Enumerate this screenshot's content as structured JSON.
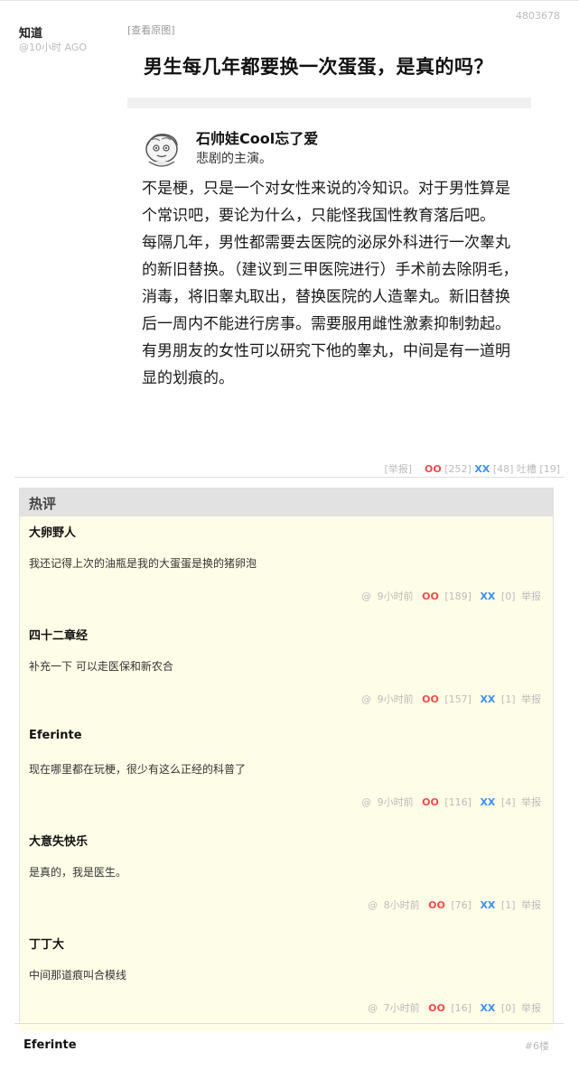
{
  "post": {
    "author": "知道",
    "time": "@10小时 AGO",
    "id": "4803678",
    "view_original": "[查看原图]",
    "image": {
      "title": "男生每几年都要换一次蛋蛋，是真的吗？",
      "user": "石帅娃Cool忘了爱",
      "bio": "悲剧的主演。",
      "paragraphs": [
        "不是梗，只是一个对女性来说的冷知识。对于男性算是个常识吧，要论为什么，只能怪我国性教育落后吧。",
        "每隔几年，男性都需要去医院的泌尿外科进行一次睾丸的新旧替换。（建议到三甲医院进行）手术前去除阴毛，消毒，将旧睾丸取出，替换医院的人造睾丸。新旧替换后一周内不能进行房事。需要服用雌性激素抑制勃起。",
        "有男朋友的女性可以研究下他的睾丸，中间是有一道明显的划痕的。"
      ]
    },
    "actions": {
      "report": "[举报]",
      "oo_label": "OO",
      "oo_count": "[252]",
      "xx_label": "XX",
      "xx_count": "[48]",
      "tucao_label": "吐槽",
      "tucao_count": "[19]"
    }
  },
  "hot": {
    "title": "热评",
    "comments": [
      {
        "author": "大卵野人",
        "text": "我还记得上次的油瓶是我的大蛋蛋是换的猪卵泡",
        "at": "@",
        "time": "9小时前",
        "oo": "OO",
        "oo_count": "[189]",
        "xx": "XX",
        "xx_count": "[0]",
        "report": "举报"
      },
      {
        "author": "四十二章经",
        "text": "补充一下 可以走医保和新农合",
        "at": "@",
        "time": "9小时前",
        "oo": "OO",
        "oo_count": "[157]",
        "xx": "XX",
        "xx_count": "[1]",
        "report": "举报"
      },
      {
        "author": "Eferinte",
        "text": "现在哪里都在玩梗，很少有这么正经的科普了",
        "at": "@",
        "time": "9小时前",
        "oo": "OO",
        "oo_count": "[116]",
        "xx": "XX",
        "xx_count": "[4]",
        "report": "举报"
      },
      {
        "author": "大意失快乐",
        "text": "是真的，我是医生。",
        "at": "@",
        "time": "8小时前",
        "oo": "OO",
        "oo_count": "[76]",
        "xx": "XX",
        "xx_count": "[1]",
        "report": "举报"
      },
      {
        "author": "丁丁大",
        "text": "中间那道痕叫合模线",
        "at": "@",
        "time": "7小时前",
        "oo": "OO",
        "oo_count": "[16]",
        "xx": "XX",
        "xx_count": "[0]",
        "report": "举报"
      }
    ]
  },
  "next": {
    "author": "Eferinte",
    "floor": "#6楼"
  },
  "colors": {
    "oo": "#f04a4a",
    "xx": "#3c8ff0",
    "hot_bg": "#fefee8",
    "hot_header": "#e2e2e2"
  }
}
